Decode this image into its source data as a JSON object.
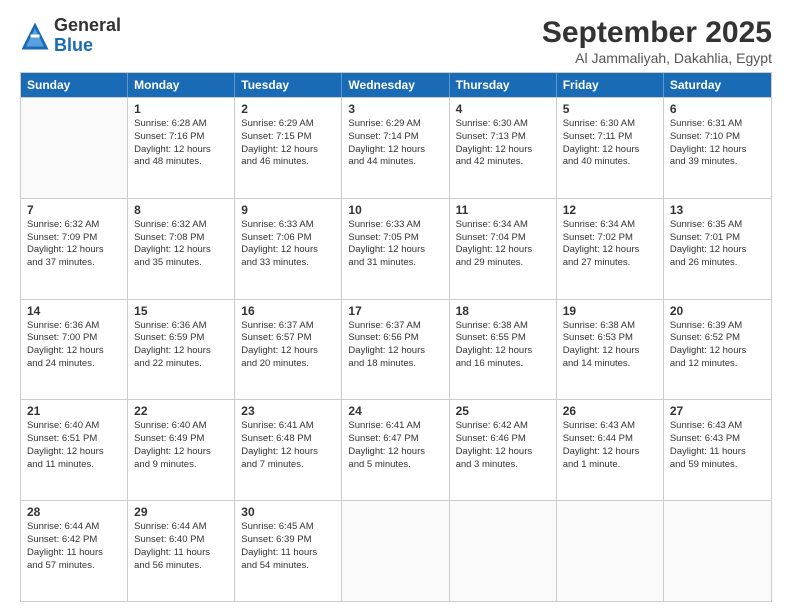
{
  "logo": {
    "general": "General",
    "blue": "Blue"
  },
  "title": "September 2025",
  "subtitle": "Al Jammaliyah, Dakahlia, Egypt",
  "header_days": [
    "Sunday",
    "Monday",
    "Tuesday",
    "Wednesday",
    "Thursday",
    "Friday",
    "Saturday"
  ],
  "rows": [
    [
      {
        "day": "",
        "empty": true
      },
      {
        "day": "1",
        "line1": "Sunrise: 6:28 AM",
        "line2": "Sunset: 7:16 PM",
        "line3": "Daylight: 12 hours",
        "line4": "and 48 minutes."
      },
      {
        "day": "2",
        "line1": "Sunrise: 6:29 AM",
        "line2": "Sunset: 7:15 PM",
        "line3": "Daylight: 12 hours",
        "line4": "and 46 minutes."
      },
      {
        "day": "3",
        "line1": "Sunrise: 6:29 AM",
        "line2": "Sunset: 7:14 PM",
        "line3": "Daylight: 12 hours",
        "line4": "and 44 minutes."
      },
      {
        "day": "4",
        "line1": "Sunrise: 6:30 AM",
        "line2": "Sunset: 7:13 PM",
        "line3": "Daylight: 12 hours",
        "line4": "and 42 minutes."
      },
      {
        "day": "5",
        "line1": "Sunrise: 6:30 AM",
        "line2": "Sunset: 7:11 PM",
        "line3": "Daylight: 12 hours",
        "line4": "and 40 minutes."
      },
      {
        "day": "6",
        "line1": "Sunrise: 6:31 AM",
        "line2": "Sunset: 7:10 PM",
        "line3": "Daylight: 12 hours",
        "line4": "and 39 minutes."
      }
    ],
    [
      {
        "day": "7",
        "line1": "Sunrise: 6:32 AM",
        "line2": "Sunset: 7:09 PM",
        "line3": "Daylight: 12 hours",
        "line4": "and 37 minutes."
      },
      {
        "day": "8",
        "line1": "Sunrise: 6:32 AM",
        "line2": "Sunset: 7:08 PM",
        "line3": "Daylight: 12 hours",
        "line4": "and 35 minutes."
      },
      {
        "day": "9",
        "line1": "Sunrise: 6:33 AM",
        "line2": "Sunset: 7:06 PM",
        "line3": "Daylight: 12 hours",
        "line4": "and 33 minutes."
      },
      {
        "day": "10",
        "line1": "Sunrise: 6:33 AM",
        "line2": "Sunset: 7:05 PM",
        "line3": "Daylight: 12 hours",
        "line4": "and 31 minutes."
      },
      {
        "day": "11",
        "line1": "Sunrise: 6:34 AM",
        "line2": "Sunset: 7:04 PM",
        "line3": "Daylight: 12 hours",
        "line4": "and 29 minutes."
      },
      {
        "day": "12",
        "line1": "Sunrise: 6:34 AM",
        "line2": "Sunset: 7:02 PM",
        "line3": "Daylight: 12 hours",
        "line4": "and 27 minutes."
      },
      {
        "day": "13",
        "line1": "Sunrise: 6:35 AM",
        "line2": "Sunset: 7:01 PM",
        "line3": "Daylight: 12 hours",
        "line4": "and 26 minutes."
      }
    ],
    [
      {
        "day": "14",
        "line1": "Sunrise: 6:36 AM",
        "line2": "Sunset: 7:00 PM",
        "line3": "Daylight: 12 hours",
        "line4": "and 24 minutes."
      },
      {
        "day": "15",
        "line1": "Sunrise: 6:36 AM",
        "line2": "Sunset: 6:59 PM",
        "line3": "Daylight: 12 hours",
        "line4": "and 22 minutes."
      },
      {
        "day": "16",
        "line1": "Sunrise: 6:37 AM",
        "line2": "Sunset: 6:57 PM",
        "line3": "Daylight: 12 hours",
        "line4": "and 20 minutes."
      },
      {
        "day": "17",
        "line1": "Sunrise: 6:37 AM",
        "line2": "Sunset: 6:56 PM",
        "line3": "Daylight: 12 hours",
        "line4": "and 18 minutes."
      },
      {
        "day": "18",
        "line1": "Sunrise: 6:38 AM",
        "line2": "Sunset: 6:55 PM",
        "line3": "Daylight: 12 hours",
        "line4": "and 16 minutes."
      },
      {
        "day": "19",
        "line1": "Sunrise: 6:38 AM",
        "line2": "Sunset: 6:53 PM",
        "line3": "Daylight: 12 hours",
        "line4": "and 14 minutes."
      },
      {
        "day": "20",
        "line1": "Sunrise: 6:39 AM",
        "line2": "Sunset: 6:52 PM",
        "line3": "Daylight: 12 hours",
        "line4": "and 12 minutes."
      }
    ],
    [
      {
        "day": "21",
        "line1": "Sunrise: 6:40 AM",
        "line2": "Sunset: 6:51 PM",
        "line3": "Daylight: 12 hours",
        "line4": "and 11 minutes."
      },
      {
        "day": "22",
        "line1": "Sunrise: 6:40 AM",
        "line2": "Sunset: 6:49 PM",
        "line3": "Daylight: 12 hours",
        "line4": "and 9 minutes."
      },
      {
        "day": "23",
        "line1": "Sunrise: 6:41 AM",
        "line2": "Sunset: 6:48 PM",
        "line3": "Daylight: 12 hours",
        "line4": "and 7 minutes."
      },
      {
        "day": "24",
        "line1": "Sunrise: 6:41 AM",
        "line2": "Sunset: 6:47 PM",
        "line3": "Daylight: 12 hours",
        "line4": "and 5 minutes."
      },
      {
        "day": "25",
        "line1": "Sunrise: 6:42 AM",
        "line2": "Sunset: 6:46 PM",
        "line3": "Daylight: 12 hours",
        "line4": "and 3 minutes."
      },
      {
        "day": "26",
        "line1": "Sunrise: 6:43 AM",
        "line2": "Sunset: 6:44 PM",
        "line3": "Daylight: 12 hours",
        "line4": "and 1 minute."
      },
      {
        "day": "27",
        "line1": "Sunrise: 6:43 AM",
        "line2": "Sunset: 6:43 PM",
        "line3": "Daylight: 11 hours",
        "line4": "and 59 minutes."
      }
    ],
    [
      {
        "day": "28",
        "line1": "Sunrise: 6:44 AM",
        "line2": "Sunset: 6:42 PM",
        "line3": "Daylight: 11 hours",
        "line4": "and 57 minutes."
      },
      {
        "day": "29",
        "line1": "Sunrise: 6:44 AM",
        "line2": "Sunset: 6:40 PM",
        "line3": "Daylight: 11 hours",
        "line4": "and 56 minutes."
      },
      {
        "day": "30",
        "line1": "Sunrise: 6:45 AM",
        "line2": "Sunset: 6:39 PM",
        "line3": "Daylight: 11 hours",
        "line4": "and 54 minutes."
      },
      {
        "day": "",
        "empty": true
      },
      {
        "day": "",
        "empty": true
      },
      {
        "day": "",
        "empty": true
      },
      {
        "day": "",
        "empty": true
      }
    ]
  ]
}
